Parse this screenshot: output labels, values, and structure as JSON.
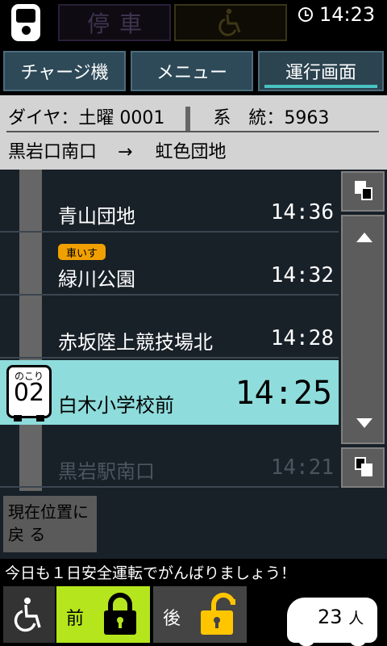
{
  "status": {
    "stop_label": "停車",
    "time": "14:23"
  },
  "tabs": [
    {
      "label": "チャージ機",
      "active": false
    },
    {
      "label": "メニュー",
      "active": false
    },
    {
      "label": "運行画面",
      "active": true
    }
  ],
  "trip": {
    "diagram": "ダイヤ：土曜 0001",
    "route": "系　統：5963",
    "origin": "黒岩口南口",
    "arrow": "→",
    "destination": "虹色団地"
  },
  "stops": [
    {
      "name": "青山団地",
      "time": "14:36",
      "badge": "",
      "state": "upcoming"
    },
    {
      "name": "緑川公園",
      "time": "14:32",
      "badge": "車いす",
      "state": "upcoming"
    },
    {
      "name": "赤坂陸上競技場北",
      "time": "14:28",
      "badge": "",
      "state": "upcoming"
    },
    {
      "name": "白木小学校前",
      "time": "14:25",
      "badge": "",
      "state": "current"
    },
    {
      "name": "黒岩駅南口",
      "time": "14:21",
      "badge": "",
      "state": "past"
    }
  ],
  "remaining": {
    "label": "のこり",
    "count": "02"
  },
  "back_button": {
    "line1": "現在位置に",
    "line2": "戻 る"
  },
  "ticker": "今日も１日安全運転でがんばりましょう！",
  "doors": {
    "front": {
      "label": "前",
      "locked": true
    },
    "rear": {
      "label": "後",
      "locked": false
    }
  },
  "passengers": {
    "count": "23",
    "unit": "人"
  },
  "colors": {
    "current_row": "#8fdcdc",
    "front_door_bg": "#b5e61d",
    "lock_yellow": "#ffc600",
    "badge": "#f0a000",
    "tab_accent": "#49c2c2"
  }
}
